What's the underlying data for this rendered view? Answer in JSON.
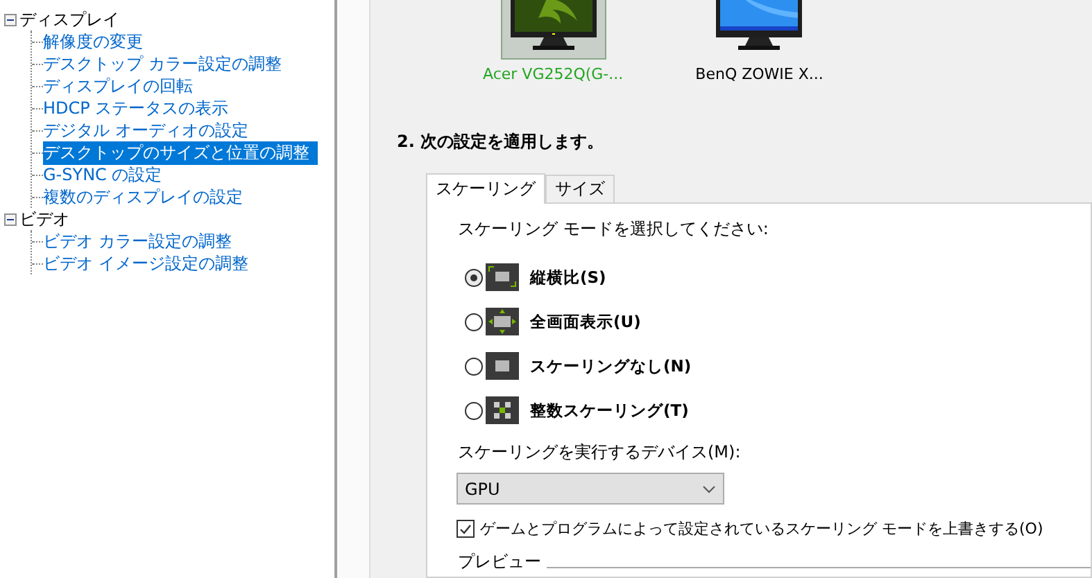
{
  "tree": [
    {
      "label": "ディスプレイ",
      "expanded": true,
      "children": [
        {
          "label": "解像度の変更",
          "selected": false
        },
        {
          "label": "デスクトップ カラー設定の調整",
          "selected": false
        },
        {
          "label": "ディスプレイの回転",
          "selected": false
        },
        {
          "label": "HDCP ステータスの表示",
          "selected": false
        },
        {
          "label": "デジタル オーディオの設定",
          "selected": false
        },
        {
          "label": "デスクトップのサイズと位置の調整",
          "selected": true
        },
        {
          "label": "G-SYNC の設定",
          "selected": false
        },
        {
          "label": "複数のディスプレイの設定",
          "selected": false
        }
      ]
    },
    {
      "label": "ビデオ",
      "expanded": true,
      "children": [
        {
          "label": "ビデオ カラー設定の調整",
          "selected": false
        },
        {
          "label": "ビデオ イメージ設定の調整",
          "selected": false
        }
      ]
    }
  ],
  "displays": [
    {
      "name": "Acer VG252Q(G-...",
      "selected": true,
      "kind": "gsync"
    },
    {
      "name": "BenQ ZOWIE X...",
      "selected": false,
      "kind": "desktop"
    }
  ],
  "step_heading": "2. 次の設定を適用します。",
  "tabs": [
    {
      "label": "スケーリング",
      "selected": true
    },
    {
      "label": "サイズ",
      "selected": false
    }
  ],
  "mode_prompt": "スケーリング モードを選択してください:",
  "modes": [
    {
      "label": "縦横比(S)",
      "selected": true,
      "kind": "aspect"
    },
    {
      "label": "全画面表示(U)",
      "selected": false,
      "kind": "full"
    },
    {
      "label": "スケーリングなし(N)",
      "selected": false,
      "kind": "none"
    },
    {
      "label": "整数スケーリング(T)",
      "selected": false,
      "kind": "integer"
    }
  ],
  "device_label": "スケーリングを実行するデバイス(M):",
  "device_select": {
    "value": "GPU"
  },
  "override": {
    "label": "ゲームとプログラムによって設定されているスケーリング モードを上書きする(O)",
    "checked": true
  },
  "preview_label": "プレビュー"
}
